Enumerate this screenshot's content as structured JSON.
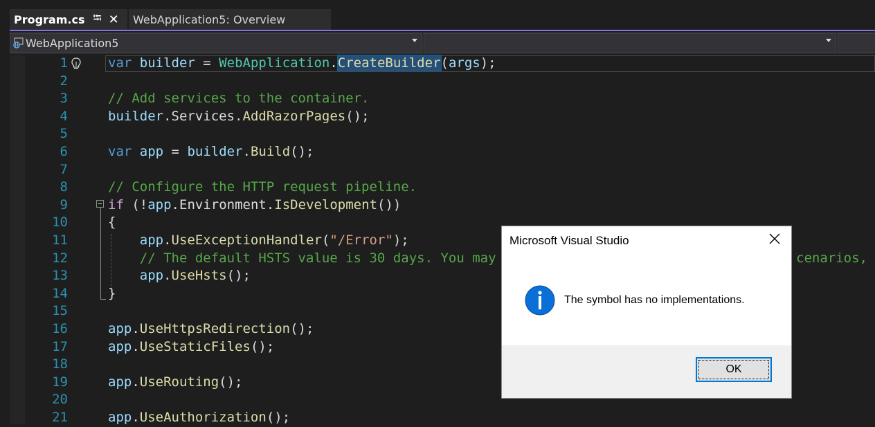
{
  "tabs": [
    {
      "label": "Program.cs",
      "active": true
    },
    {
      "label": "WebApplication5: Overview",
      "active": false
    }
  ],
  "icons": {
    "pin": "pin-icon",
    "close": "close-icon",
    "project": "globe-project-icon",
    "lightbulb": "lightbulb-icon",
    "info": "info-icon",
    "dropdown": "chevron-down-icon"
  },
  "navbar": {
    "project": "WebApplication5",
    "member": ""
  },
  "editor": {
    "lines": [
      {
        "n": "1"
      },
      {
        "n": "2"
      },
      {
        "n": "3"
      },
      {
        "n": "4"
      },
      {
        "n": "5"
      },
      {
        "n": "6"
      },
      {
        "n": "7"
      },
      {
        "n": "8"
      },
      {
        "n": "9"
      },
      {
        "n": "10"
      },
      {
        "n": "11"
      },
      {
        "n": "12"
      },
      {
        "n": "13"
      },
      {
        "n": "14"
      },
      {
        "n": "15"
      },
      {
        "n": "16"
      },
      {
        "n": "17"
      },
      {
        "n": "18"
      },
      {
        "n": "19"
      },
      {
        "n": "20"
      },
      {
        "n": "21"
      }
    ],
    "code": {
      "l1": {
        "var": "var",
        "builder": "builder",
        "eq": " = ",
        "type": "WebApplication",
        "dot": ".",
        "method": "CreateBuilder",
        "args_open": "(",
        "args": "args",
        "end": ");"
      },
      "l3": "// Add services to the container.",
      "l4": {
        "obj": "builder",
        "dot1": ".",
        "prop": "Services",
        "dot2": ".",
        "method": "AddRazorPages",
        "end": "();"
      },
      "l6": {
        "var": "var",
        "app": "app",
        "eq": " = ",
        "builder": "builder",
        "dot": ".",
        "method": "Build",
        "end": "();"
      },
      "l8": "// Configure the HTTP request pipeline.",
      "l9": {
        "if": "if",
        "open": " (!",
        "app": "app",
        "dot1": ".",
        "prop": "Environment",
        "dot2": ".",
        "method": "IsDevelopment",
        "end": "())"
      },
      "l10": "{",
      "l11": {
        "indent": "    ",
        "app": "app",
        "dot": ".",
        "method": "UseExceptionHandler",
        "open": "(",
        "str": "\"/Error\"",
        "end": ");"
      },
      "l12": {
        "indent": "    ",
        "comment_a": "// The default HSTS value is 30 days. You may",
        "comment_b": "cenarios, s"
      },
      "l13": {
        "indent": "    ",
        "app": "app",
        "dot": ".",
        "method": "UseHsts",
        "end": "();"
      },
      "l14": "}",
      "l16": {
        "app": "app",
        "dot": ".",
        "method": "UseHttpsRedirection",
        "end": "();"
      },
      "l17": {
        "app": "app",
        "dot": ".",
        "method": "UseStaticFiles",
        "end": "();"
      },
      "l19": {
        "app": "app",
        "dot": ".",
        "method": "UseRouting",
        "end": "();"
      },
      "l21": {
        "app": "app",
        "dot": ".",
        "method": "UseAuthorization",
        "end": "();"
      }
    }
  },
  "dialog": {
    "title": "Microsoft Visual Studio",
    "message": "The symbol has no implementations.",
    "ok_label": "OK"
  },
  "colors": {
    "accent": "#8a6fe8",
    "editor_bg": "#1e1e1e",
    "line_number": "#2b91af",
    "keyword": "#569cd6",
    "type": "#4ec9b0",
    "method": "#dcdcaa",
    "variable": "#9cdcfe",
    "comment": "#57a64a",
    "string": "#d69d85",
    "control_keyword": "#d8a0df",
    "dialog_button_border": "#0078d7"
  }
}
